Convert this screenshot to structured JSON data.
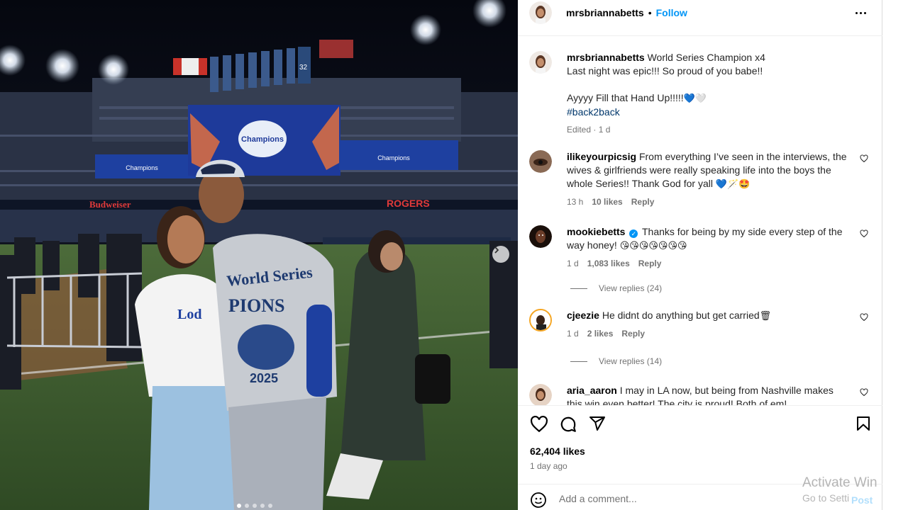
{
  "post": {
    "author": "mrsbriannabetts",
    "header_separator": "•",
    "follow_label": "Follow",
    "caption_lines": [
      "World Series Champion x4",
      "Last night was epic!!! So proud of you babe!!",
      "",
      "Ayyyy Fill that Hand Up!!!!!"
    ],
    "caption_emoji": "💙🤍",
    "hashtag": "#back2back",
    "edited": "Edited · 1 d",
    "likes": "62,404 likes",
    "time_ago": "1 day ago"
  },
  "photo_signs": {
    "champions_board": "World Series Champions",
    "sponsor_left": "Budweiser",
    "sponsor_right": "ROGERS",
    "retired_number": "32",
    "shirt_text": "World Series CHAMPIONS 2025"
  },
  "comments": [
    {
      "user": "ilikeyourpicsig",
      "text": "From everything I’ve seen in the interviews, the wives & girlfriends were really speaking life into the boys the whole Series!! Thank God for yall",
      "emoji": "💙🪄🤩",
      "time": "13 h",
      "likes": "10 likes",
      "reply": "Reply"
    },
    {
      "user": "mookiebetts",
      "verified": "✓",
      "text": "Thanks for being by my side every step of the way honey!",
      "emoji": "😘😘😘😘😘😘😘",
      "time": "1 d",
      "likes": "1,083 likes",
      "reply": "Reply",
      "view_replies": "View replies (24)"
    },
    {
      "user": "cjeezie",
      "text": "He didnt do anything but get carried",
      "emoji": "🗑",
      "time": "1 d",
      "likes": "2 likes",
      "reply": "Reply",
      "view_replies": "View replies (14)"
    },
    {
      "user": "aria_aaron",
      "text": "I may in LA now, but being from Nashville makes this win even better! The city is proud! Both of em!"
    }
  ],
  "add_comment": {
    "placeholder": "Add a comment...",
    "post_label": "Post"
  },
  "icons": {
    "carousel_next": "chevron-right-icon",
    "like": "heart-icon",
    "comment": "comment-icon",
    "share": "paper-plane-icon",
    "save": "bookmark-icon",
    "emoji": "smiley-icon",
    "more": "more-horizontal-icon"
  },
  "colors": {
    "follow_blue": "#0095f6",
    "hashtag": "#00376b",
    "meta_gray": "#737373",
    "post_disabled": "#b2dffc",
    "dodger_blue": "#1e40a0"
  },
  "carousel": {
    "count": 5,
    "active_index": 0
  },
  "watermark": {
    "line1": "Activate Win",
    "line2": "Go to Setti"
  }
}
